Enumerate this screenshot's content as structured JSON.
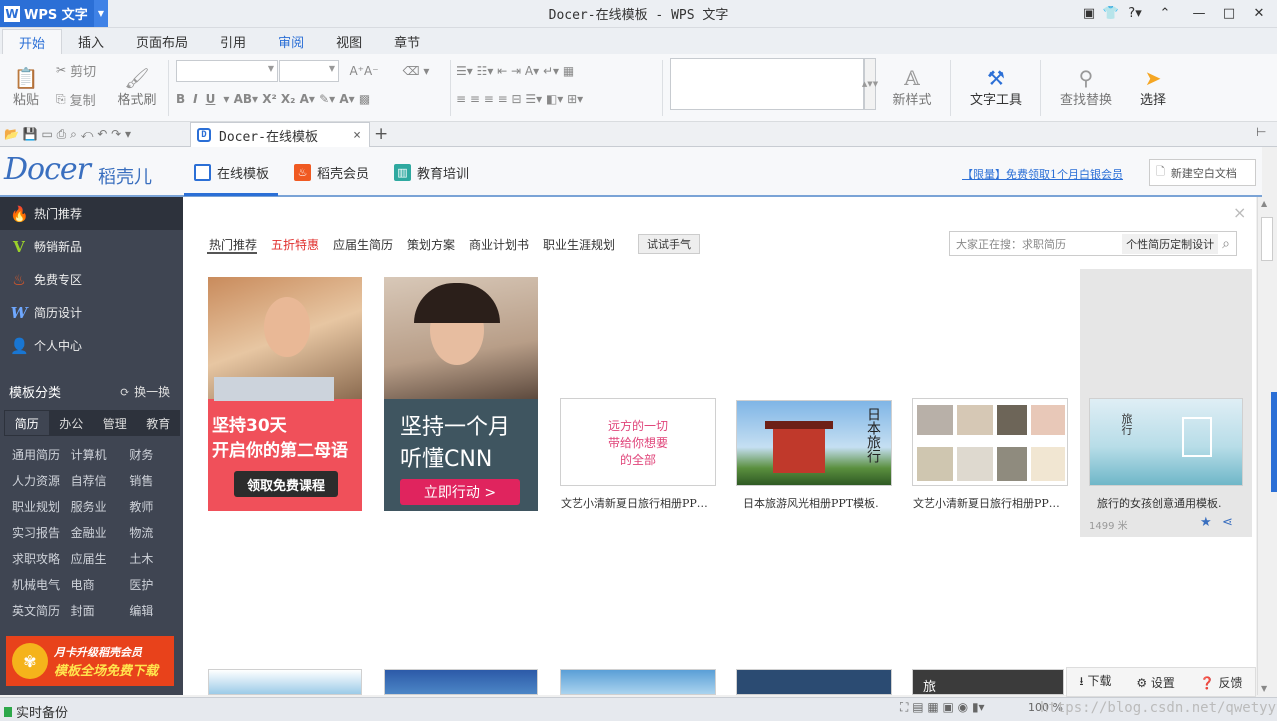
{
  "app": {
    "name": "WPS 文字",
    "window_title": "Docer-在线模板 - WPS 文字",
    "help": "?"
  },
  "menu_tabs": [
    "开始",
    "插入",
    "页面布局",
    "引用",
    "审阅",
    "视图",
    "章节"
  ],
  "ribbon": {
    "paste": "粘贴",
    "cut": "剪切",
    "copy": "复制",
    "format_painter": "格式刷",
    "new_style": "新样式",
    "text_tools": "文字工具",
    "find_replace": "查找替换",
    "select": "选择"
  },
  "doc_tab": {
    "title": "Docer-在线模板",
    "close": "×",
    "new": "+"
  },
  "header": {
    "brand": "Docer",
    "brand_cn": "稻壳儿",
    "nav": [
      "在线模板",
      "稻壳会员",
      "教育培训"
    ],
    "promo": "【限量】免费领取1个月白银会员",
    "new_blank": "新建空白文档"
  },
  "sidebar": {
    "items": [
      "热门推荐",
      "畅销新品",
      "免费专区",
      "简历设计",
      "个人中心"
    ],
    "category_title": "模板分类",
    "swap": "换一换",
    "cat_tabs": [
      "简历",
      "办公",
      "管理",
      "教育"
    ],
    "categories": [
      "通用简历",
      "计算机",
      "财务",
      "人力资源",
      "自荐信",
      "销售",
      "职业规划",
      "服务业",
      "教师",
      "实习报告",
      "金融业",
      "物流",
      "求职攻略",
      "应届生",
      "土木",
      "机械电气",
      "电商",
      "医护",
      "英文简历",
      "封面",
      "编辑"
    ],
    "banner_line1": "月卡升级稻壳会员",
    "banner_line2": "模板全场免费下载"
  },
  "content": {
    "close": "×",
    "tabs": [
      "热门推荐",
      "五折特惠",
      "应届生简历",
      "策划方案",
      "商业计划书",
      "职业生涯规划"
    ],
    "try_luck": "试试手气",
    "search_placeholder": "大家正在搜：求职简历",
    "search_tag": "个性简历定制设计",
    "ad1": {
      "line1": "坚持30天",
      "line2": "开启你的第二母语",
      "button": "领取免费课程"
    },
    "ad2": {
      "line1": "坚持一个月",
      "line2": "听懂CNN",
      "button": "立即行动 >"
    },
    "templates": [
      {
        "caption": "文艺小清新夏日旅行相册PP…",
        "thumb_text1": "远方的一切",
        "thumb_text2": "带给你想要",
        "thumb_text3": "的全部"
      },
      {
        "caption": "日本旅游风光相册PPT模板.",
        "thumb_text1": "日本旅行"
      },
      {
        "caption": "文艺小清新夏日旅行相册PP…"
      },
      {
        "caption": "旅行的女孩创意通用模板.",
        "thumb_text1": "旅行",
        "size": "1499 米"
      }
    ],
    "bottom_thumb_text": "旅"
  },
  "floating_actions": [
    "下载",
    "设置",
    "反馈"
  ],
  "status": {
    "backup": "实时备份",
    "zoom": "100 %",
    "watermark": "https://blog.csdn.net/qwetyyy"
  },
  "colors": {
    "accent": "#2b6fd6",
    "sidebar": "#3f4552",
    "promo": "#2b6fd6",
    "ad1": "#f0505a",
    "ad2": "#e0245e"
  }
}
